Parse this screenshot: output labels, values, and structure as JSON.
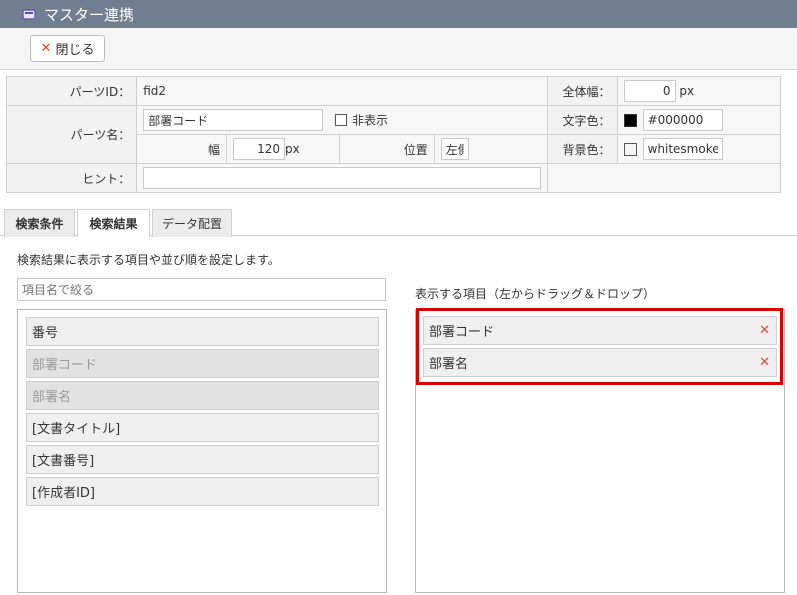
{
  "window": {
    "title": "マスター連携"
  },
  "toolbar": {
    "close_label": "閉じる"
  },
  "props": {
    "parts_id_label": "パーツID：",
    "parts_id_value": "fid2",
    "total_width_label": "全体幅：",
    "total_width_value": "0",
    "total_width_unit": "px",
    "parts_name_label": "パーツ名：",
    "parts_name_value": "部署コード",
    "hide_label": "非表示",
    "text_color_label": "文字色：",
    "text_color_value": "#000000",
    "width_label": "幅",
    "width_value": "120",
    "width_unit": "px",
    "position_label": "位置",
    "position_value": "左側",
    "bg_color_label": "背景色：",
    "bg_color_value": "whitesmoke",
    "hint_label": "ヒント：",
    "hint_value": ""
  },
  "tabs": [
    "検索条件",
    "検索結果",
    "データ配置"
  ],
  "main": {
    "description": "検索結果に表示する項目や並び順を設定します。",
    "filter_placeholder": "項目名で絞る",
    "available_items": [
      {
        "label": "番号",
        "disabled": false
      },
      {
        "label": "部署コード",
        "disabled": true
      },
      {
        "label": "部署名",
        "disabled": true
      },
      {
        "label": "[文書タイトル]",
        "disabled": false
      },
      {
        "label": "[文書番号]",
        "disabled": false
      },
      {
        "label": "[作成者ID]",
        "disabled": false
      }
    ],
    "selected_title": "表示する項目（左からドラッグ＆ドロップ）",
    "selected_items": [
      "部署コード",
      "部署名"
    ]
  },
  "colors": {
    "titlebar": "#6f7f8f",
    "highlight": "#d90000",
    "delete": "#e04b2b"
  }
}
